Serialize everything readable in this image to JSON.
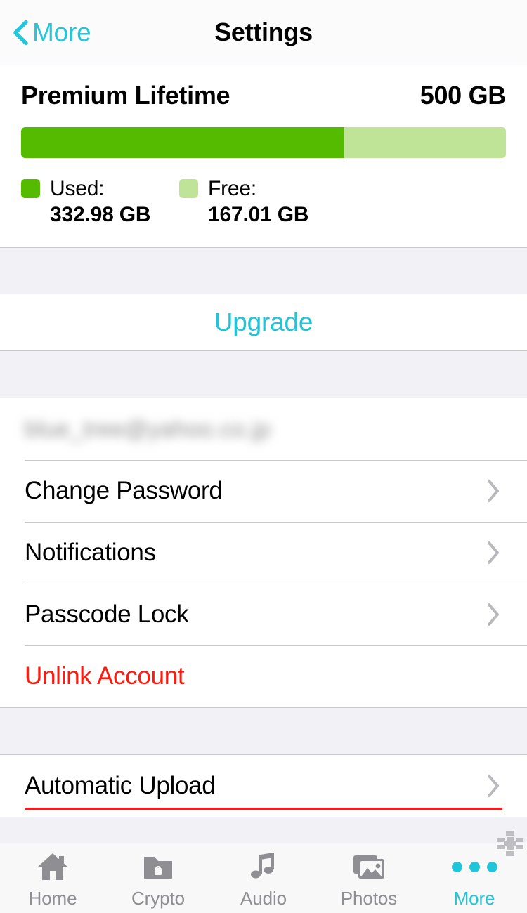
{
  "navbar": {
    "back_label": "More",
    "back_icon": "chevron-left-icon",
    "title": "Settings"
  },
  "storage": {
    "plan_name": "Premium Lifetime",
    "quota": "500 GB",
    "used_label": "Used:",
    "used_value": "332.98 GB",
    "free_label": "Free:",
    "free_value": "167.01 GB",
    "used_percent": 66.6,
    "used_color": "#55bb00",
    "free_color": "#c0e497"
  },
  "upgrade": {
    "label": "Upgrade"
  },
  "account": {
    "email": "blue_tree@yahoo.co.jp",
    "rows": [
      {
        "label": "Change Password",
        "accessory": "chevron-right-icon"
      },
      {
        "label": "Notifications",
        "accessory": "chevron-right-icon"
      },
      {
        "label": "Passcode Lock",
        "accessory": "chevron-right-icon"
      },
      {
        "label": "Unlink Account",
        "accessory": "none",
        "destructive": true
      }
    ]
  },
  "upload": {
    "rows": [
      {
        "label": "Automatic Upload",
        "accessory": "chevron-right-icon",
        "annotated": true
      }
    ],
    "annotation_color": "#f8181c"
  },
  "tabbar": {
    "items": [
      {
        "label": "Home",
        "icon": "house-icon",
        "active": false
      },
      {
        "label": "Crypto",
        "icon": "folder-lock-icon",
        "active": false
      },
      {
        "label": "Audio",
        "icon": "music-note-icon",
        "active": false
      },
      {
        "label": "Photos",
        "icon": "photos-icon",
        "active": false
      },
      {
        "label": "More",
        "icon": "ellipsis-icon",
        "active": true
      }
    ],
    "handle_icon": "resize-handle-icon",
    "active_color": "#21c5d9",
    "inactive_color": "#8e8e93"
  }
}
